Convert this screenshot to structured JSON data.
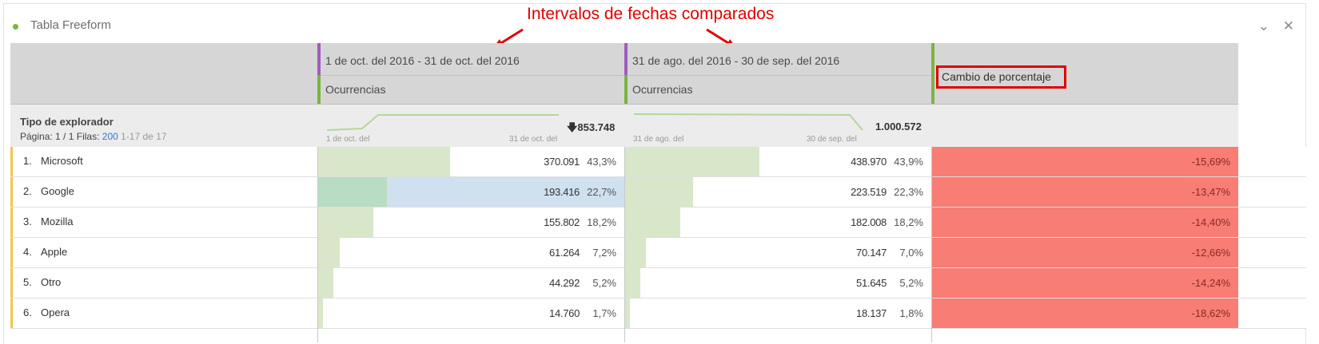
{
  "panel": {
    "title": "Tabla Freeform"
  },
  "annotation": {
    "text": "Intervalos de fechas comparados"
  },
  "columns": [
    {
      "date_range": "1 de oct. del 2016 - 31 de oct. del 2016",
      "metric": "Ocurrencias",
      "spark_start": "1 de oct. del",
      "spark_end": "31 de oct. del",
      "total": "853.748",
      "total_icon": "down-arrow-icon"
    },
    {
      "date_range": "31 de ago. del 2016 - 30 de sep. del 2016",
      "metric": "Ocurrencias",
      "spark_start": "31 de ago. del",
      "spark_end": "30 de sep. del",
      "total": "1.000.572"
    }
  ],
  "change_column": {
    "label": "Cambio de porcentaje"
  },
  "dimension": {
    "title": "Tipo de explorador",
    "page_label": "Página:",
    "page": "1 / 1",
    "rows_label": "Filas:",
    "rows_value": "200",
    "range": "1-17 de 17"
  },
  "rows": [
    {
      "num": "1.",
      "name": "Microsoft",
      "v1": "370.091",
      "p1": "43,3%",
      "f1": 0.433,
      "v2": "438.970",
      "p2": "43,9%",
      "f2": 0.439,
      "change": "-15,69%"
    },
    {
      "num": "2.",
      "name": "Google",
      "v1": "193.416",
      "p1": "22,7%",
      "f1": 0.227,
      "v2": "223.519",
      "p2": "22,3%",
      "f2": 0.223,
      "change": "-13,47%"
    },
    {
      "num": "3.",
      "name": "Mozilla",
      "v1": "155.802",
      "p1": "18,2%",
      "f1": 0.182,
      "v2": "182.008",
      "p2": "18,2%",
      "f2": 0.182,
      "change": "-14,40%"
    },
    {
      "num": "4.",
      "name": "Apple",
      "v1": "61.264",
      "p1": "7,2%",
      "f1": 0.072,
      "v2": "70.147",
      "p2": "7,0%",
      "f2": 0.07,
      "change": "-12,66%"
    },
    {
      "num": "5.",
      "name": "Otro",
      "v1": "44.292",
      "p1": "5,2%",
      "f1": 0.052,
      "v2": "51.645",
      "p2": "5,2%",
      "f2": 0.052,
      "change": "-14,24%"
    },
    {
      "num": "6.",
      "name": "Opera",
      "v1": "14.760",
      "p1": "1,7%",
      "f1": 0.017,
      "v2": "18.137",
      "p2": "1,8%",
      "f2": 0.018,
      "change": "-18,62%"
    }
  ],
  "colors": {
    "accent_purple": "#a05cbf",
    "accent_green": "#7cb342",
    "bar_fill": "#d8e7c9",
    "selected_row": "#cfe0ee",
    "negative_change": "#f87d74",
    "annotation": "#e00000"
  },
  "icons": {
    "collapse": "chevron-down-icon",
    "close": "close-icon"
  }
}
